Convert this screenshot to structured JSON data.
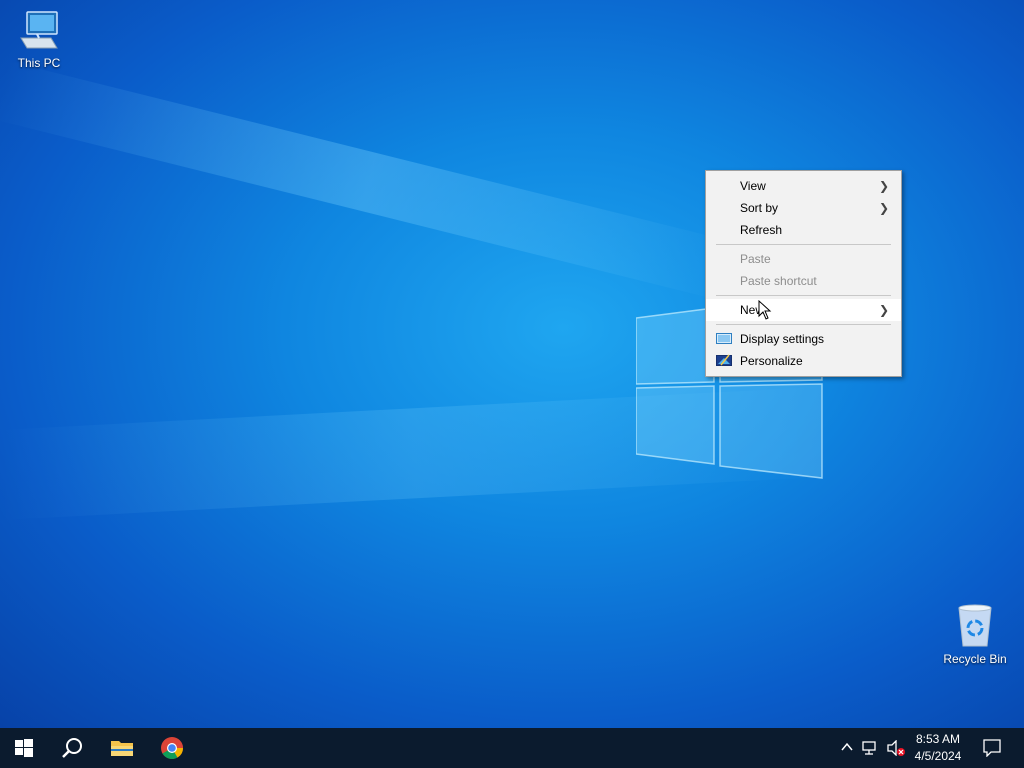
{
  "desktop": {
    "icons": [
      {
        "label": "This PC",
        "icon": "this-pc-icon"
      },
      {
        "label": "Recycle Bin",
        "icon": "recycle-bin-icon"
      }
    ]
  },
  "context_menu": {
    "items": {
      "view": {
        "label": "View",
        "has_submenu": true
      },
      "sort_by": {
        "label": "Sort by",
        "has_submenu": true
      },
      "refresh": {
        "label": "Refresh"
      },
      "paste": {
        "label": "Paste",
        "disabled": true
      },
      "paste_shortcut": {
        "label": "Paste shortcut",
        "disabled": true
      },
      "new": {
        "label": "New",
        "has_submenu": true
      },
      "display_settings": {
        "label": "Display settings",
        "icon": "display-settings-icon"
      },
      "personalize": {
        "label": "Personalize",
        "icon": "personalize-icon"
      }
    }
  },
  "taskbar": {
    "buttons": [
      "start-icon",
      "search-icon",
      "file-explorer-icon",
      "chrome-icon"
    ],
    "tray": [
      "chevron-up-icon",
      "network-icon",
      "volume-muted-icon",
      "notification-icon"
    ],
    "clock": {
      "time": "8:53 AM",
      "date": "4/5/2024"
    }
  },
  "colors": {
    "taskbar": "#0b1b2e",
    "desktop_accent": "#0f86e0",
    "menu_bg": "#f2f2f2"
  }
}
